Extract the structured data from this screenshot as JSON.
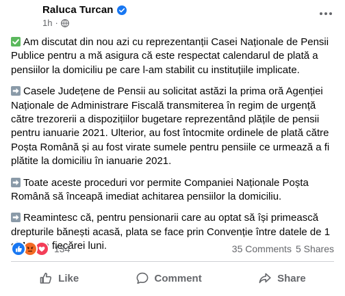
{
  "post": {
    "author": "Raluca Turcan",
    "timestamp": "1h",
    "separator": "·",
    "paragraphs": [
      {
        "icon": "check-mark-emoji",
        "text": "Am discutat din nou azi cu reprezentanții Casei Naționale de Pensii Publice pentru a mă asigura că este respectat calendarul de plată a pensiilor la domiciliu pe care l-am stabilit cu instituțiile implicate."
      },
      {
        "icon": "right-arrow-emoji",
        "text": "Casele Județene de Pensii au solicitat astăzi la prima oră Agenției Naționale de Administrare Fiscală transmiterea în regim de urgență către trezorerii a dispozițiilor bugetare reprezentând plățile de pensii pentru ianuarie 2021. Ulterior, au fost întocmite ordinele de plată către Poșta Română și au fost virate sumele pentru pensiile ce urmează a fi plătite la domiciliu în ianuarie 2021."
      },
      {
        "icon": "right-arrow-emoji",
        "text": "Toate aceste proceduri vor permite Companiei Naționale Poșta Română să înceapă imediat achitarea pensiilor la domiciliu."
      },
      {
        "icon": "right-arrow-emoji",
        "text": "Reamintesc că, pentru pensionarii care au optat să își primească drepturile bănești acasă, plata se face prin Convenție între datele de 1 și 15 ale fiecărei luni."
      }
    ]
  },
  "stats": {
    "reaction_count": "134",
    "comments": "35 Comments",
    "shares": "5 Shares",
    "reactions": [
      "like-reaction-icon",
      "angry-reaction-icon",
      "love-reaction-icon"
    ]
  },
  "actions": {
    "like": "Like",
    "comment": "Comment",
    "share": "Share"
  },
  "colors": {
    "text": "#050505",
    "secondary": "#65676b",
    "divider": "#ced0d4",
    "verified": "#1877f2",
    "like": "#1877f2",
    "angry": "#f26a24",
    "love": "#f33e58",
    "check_emoji": "#5bb85d",
    "arrow_emoji": "#8a9aa8"
  }
}
